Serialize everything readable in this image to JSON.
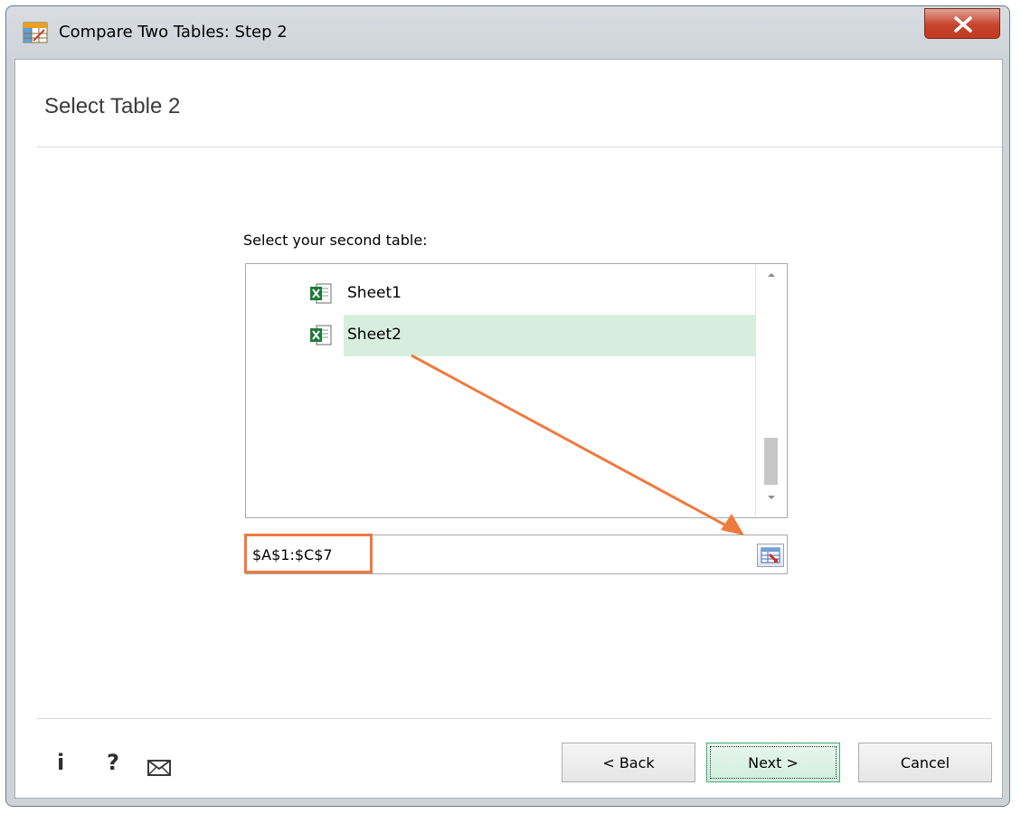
{
  "window": {
    "title": "Compare Two Tables: Step 2",
    "close_symbol": "x"
  },
  "page": {
    "title": "Select Table 2",
    "prompt": "Select your second table:"
  },
  "tables_list": {
    "items": [
      {
        "label": "Sheet1",
        "icon": "excel-sheet-icon",
        "selected": false
      },
      {
        "label": "Sheet2",
        "icon": "excel-sheet-icon",
        "selected": true
      }
    ]
  },
  "range": {
    "value": "$A$1:$C$7"
  },
  "footer": {
    "info_symbol": "i",
    "help_symbol": "?",
    "mail_icon": "envelope-icon"
  },
  "buttons": {
    "back": "< Back",
    "next": "Next >",
    "cancel": "Cancel"
  },
  "colors": {
    "selection": "#d7eedf",
    "annotation": "#ee7b3e",
    "next_border": "#3fa97a"
  }
}
